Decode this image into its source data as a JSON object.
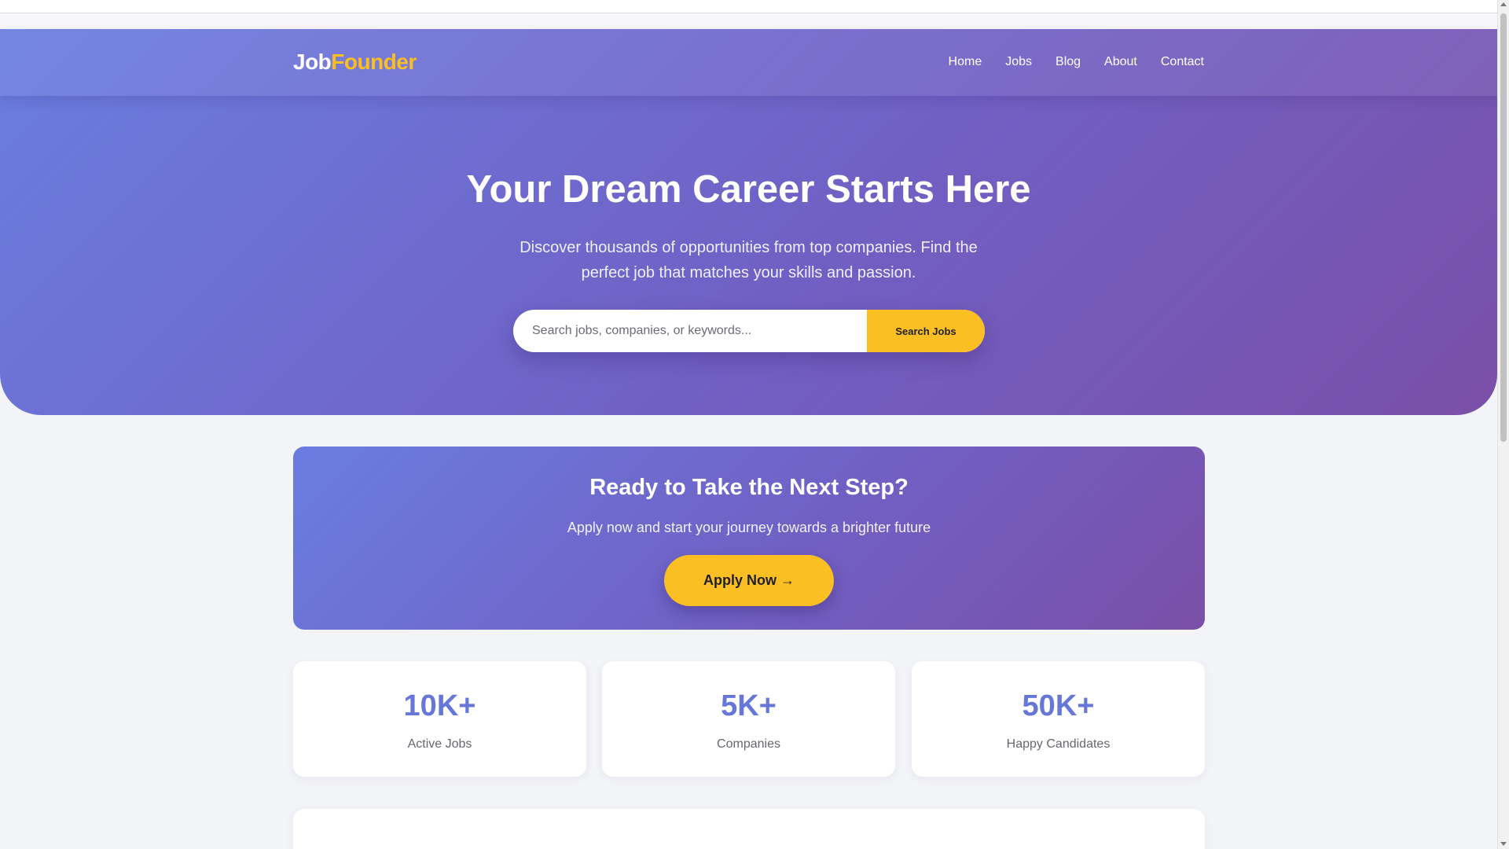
{
  "brand": {
    "part1": "Job",
    "part2": "Founder"
  },
  "nav": {
    "items": [
      {
        "label": "Home"
      },
      {
        "label": "Jobs"
      },
      {
        "label": "Blog"
      },
      {
        "label": "About"
      },
      {
        "label": "Contact"
      }
    ]
  },
  "hero": {
    "title": "Your Dream Career Starts Here",
    "subtitle": "Discover thousands of opportunities from top companies. Find the perfect job that matches your skills and passion.",
    "search": {
      "placeholder": "Search jobs, companies, or keywords...",
      "value": "",
      "button_label": "Search Jobs"
    }
  },
  "cta": {
    "title": "Ready to Take the Next Step?",
    "subtitle": "Apply now and start your journey towards a brighter future",
    "button_label": "Apply Now →"
  },
  "stats": [
    {
      "value": "10K+",
      "label": "Active Jobs"
    },
    {
      "value": "5K+",
      "label": "Companies"
    },
    {
      "value": "50K+",
      "label": "Happy Candidates"
    }
  ],
  "colors": {
    "accent": "#fbbf24",
    "gradient_start": "#6a7de0",
    "gradient_end": "#7a4fa8",
    "stat_value": "#6677d8",
    "page_background": "#f3f4f8"
  }
}
